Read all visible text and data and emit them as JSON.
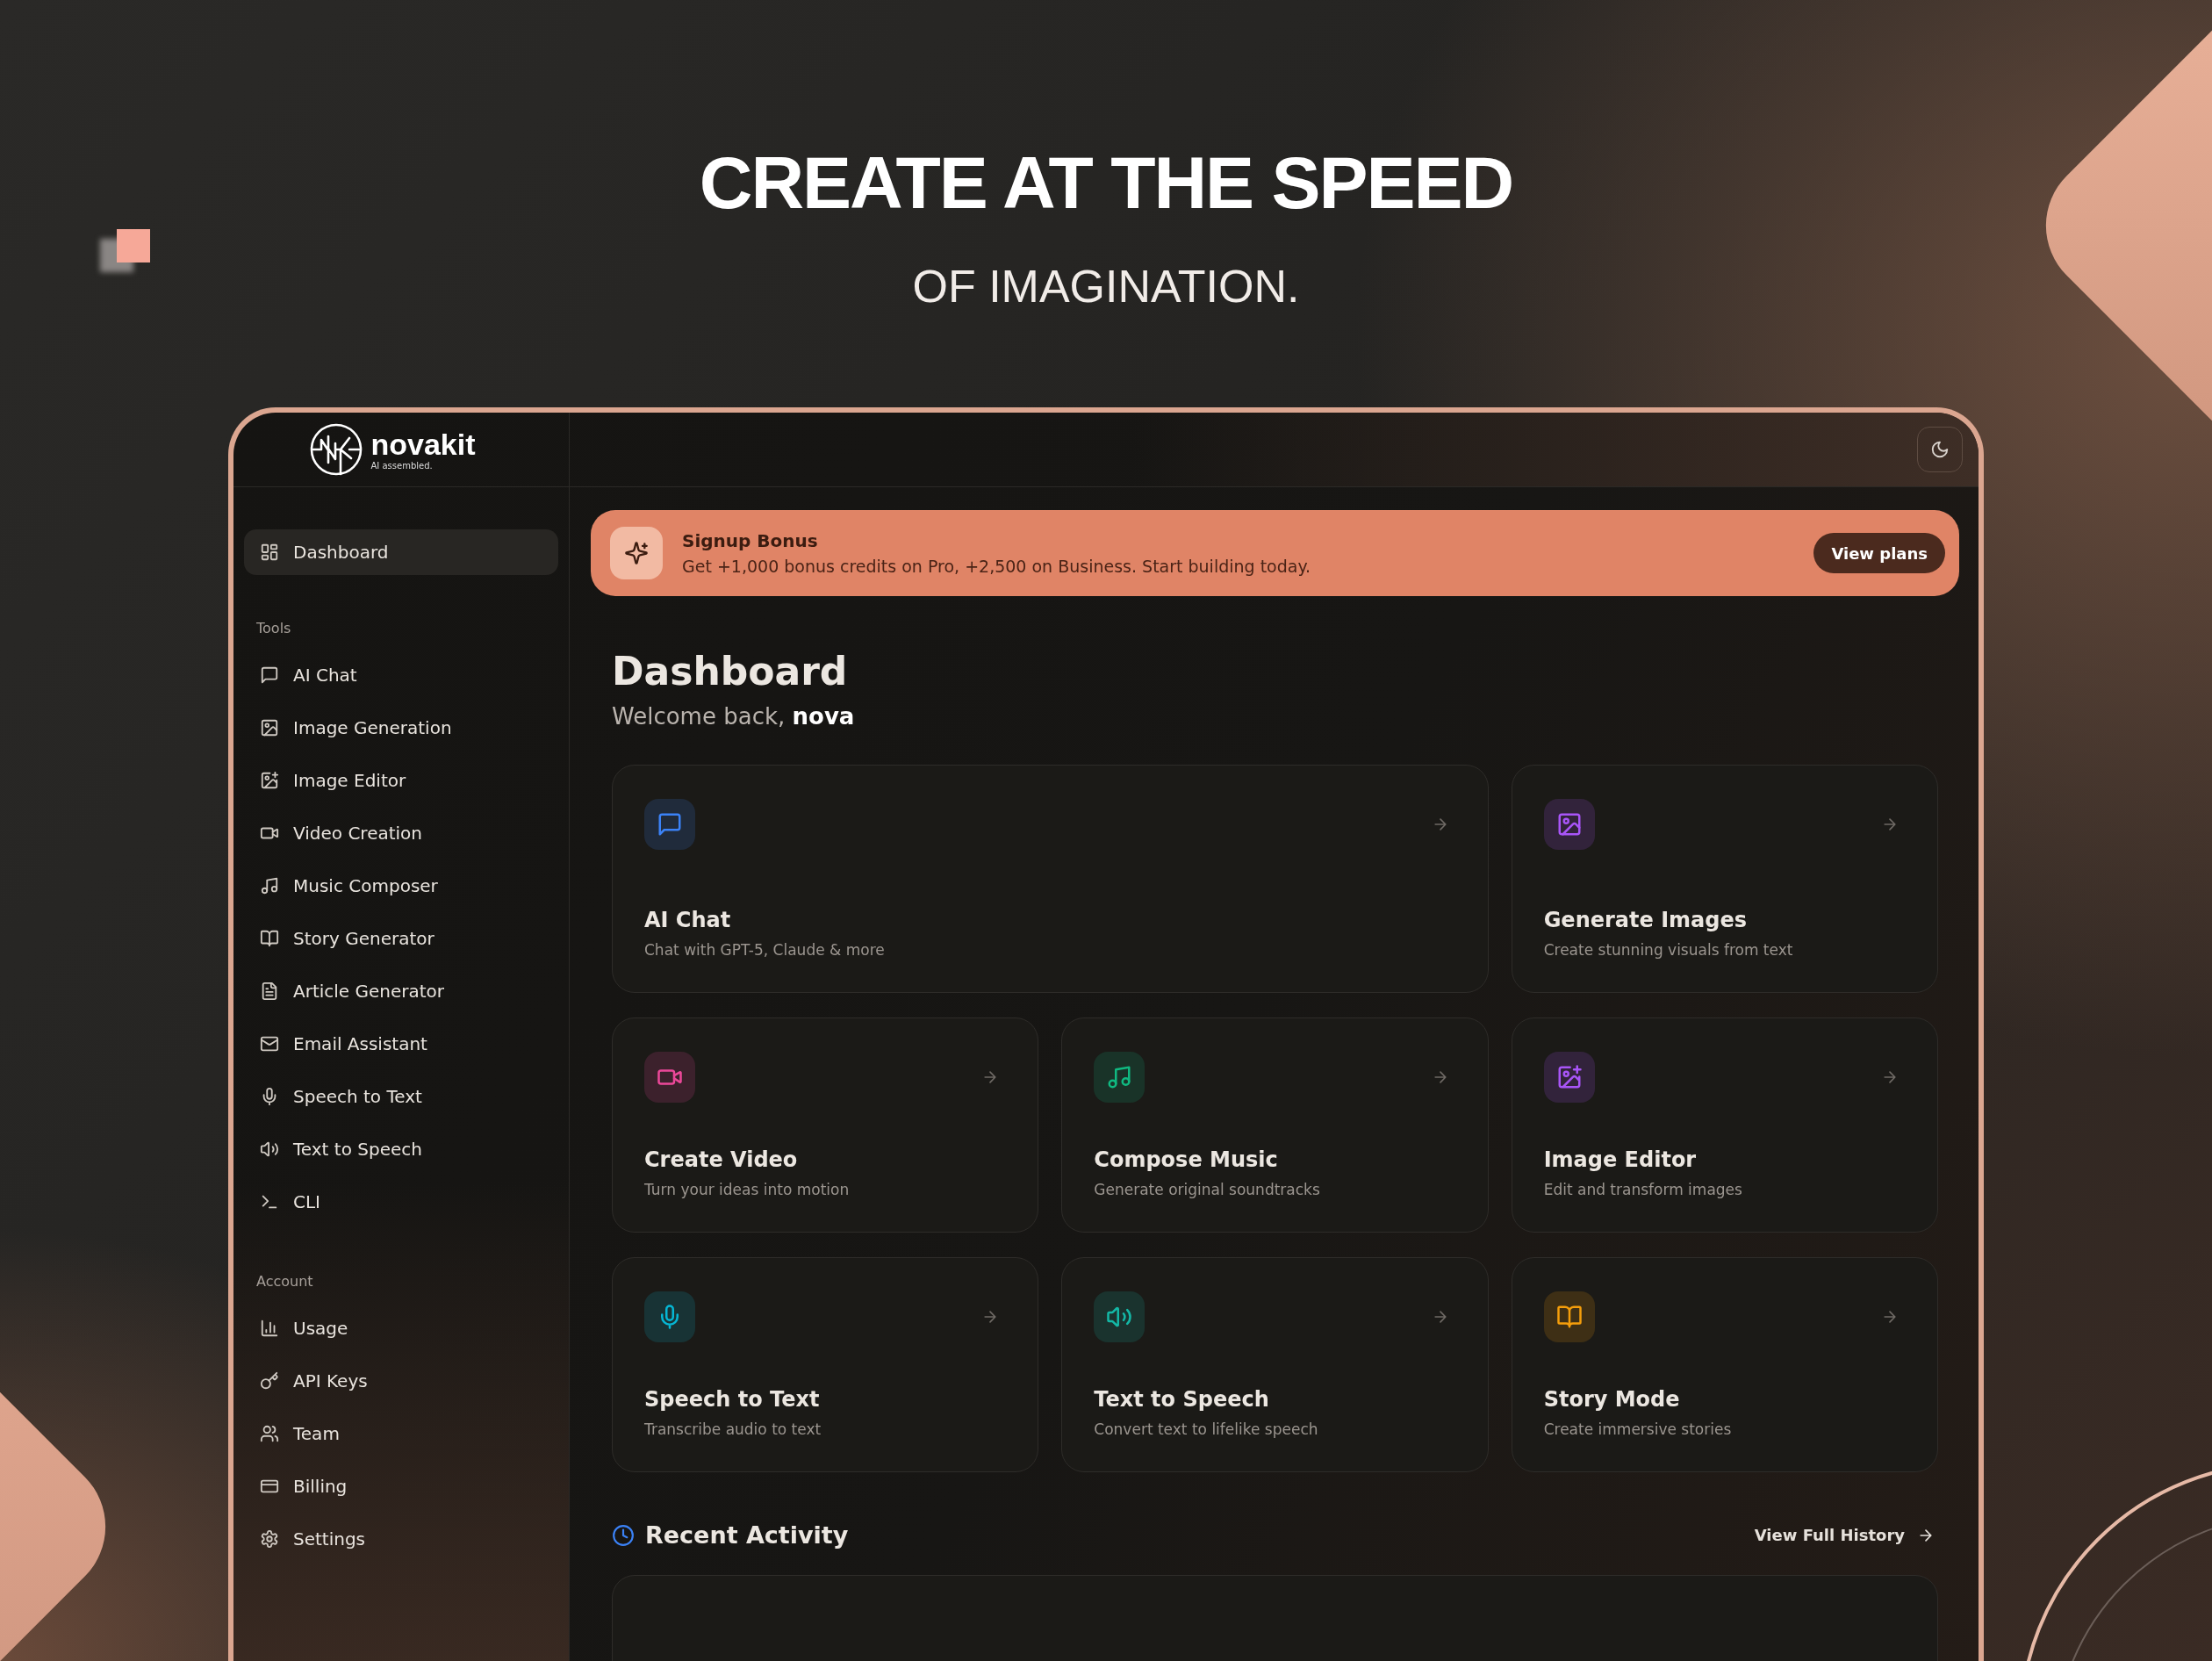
{
  "hero": {
    "title": "CREATE AT THE SPEED",
    "subtitle": "OF IMAGINATION."
  },
  "sidebar": {
    "logo": {
      "name": "novakit",
      "tagline": "AI assembled."
    },
    "sections": [
      {
        "items": [
          {
            "label": "Dashboard",
            "kind": "dashboard",
            "selected": true
          }
        ]
      },
      {
        "heading": "Tools",
        "items": [
          {
            "label": "AI Chat",
            "kind": "chat",
            "selected": false
          },
          {
            "label": "Image Generation",
            "kind": "image",
            "selected": false
          },
          {
            "label": "Image Editor",
            "kind": "imageplus",
            "selected": false
          },
          {
            "label": "Video Creation",
            "kind": "video",
            "selected": false
          },
          {
            "label": "Music Composer",
            "kind": "music",
            "selected": false
          },
          {
            "label": "Story Generator",
            "kind": "book",
            "selected": false
          },
          {
            "label": "Article Generator",
            "kind": "file",
            "selected": false
          },
          {
            "label": "Email Assistant",
            "kind": "mail",
            "selected": false
          },
          {
            "label": "Speech to Text",
            "kind": "mic",
            "selected": false
          },
          {
            "label": "Text to Speech",
            "kind": "speaker",
            "selected": false
          },
          {
            "label": "CLI",
            "kind": "terminal",
            "selected": false
          }
        ]
      },
      {
        "heading": "Account",
        "items": [
          {
            "label": "Usage",
            "kind": "chart",
            "selected": false
          },
          {
            "label": "API Keys",
            "kind": "key",
            "selected": false
          },
          {
            "label": "Team",
            "kind": "users",
            "selected": false
          },
          {
            "label": "Billing",
            "kind": "card",
            "selected": false
          },
          {
            "label": "Settings",
            "kind": "settings",
            "selected": false
          }
        ]
      }
    ]
  },
  "banner": {
    "title": "Signup Bonus",
    "text": "Get +1,000 bonus credits on Pro, +2,500 on Business. Start building today.",
    "button": "View plans"
  },
  "dashboard": {
    "title": "Dashboard",
    "greeting": "Welcome back, **nova**",
    "cards": [
      {
        "title": "AI Chat",
        "description": "Chat with GPT-5, Claude & more",
        "kind": "chat",
        "color": "#3b82f6"
      },
      {
        "title": "Generate Images",
        "description": "Create stunning visuals from text",
        "kind": "image",
        "color": "#a855f7"
      },
      {
        "title": "Create Video",
        "description": "Turn your ideas into motion",
        "kind": "video",
        "color": "#ec4899"
      },
      {
        "title": "Compose Music",
        "description": "Generate original soundtracks",
        "kind": "music",
        "color": "#10b981"
      },
      {
        "title": "Image Editor",
        "description": "Edit and transform images",
        "kind": "imageplus",
        "color": "#a855f7"
      },
      {
        "title": "Speech to Text",
        "description": "Transcribe audio to text",
        "kind": "mic",
        "color": "#06b6d4"
      },
      {
        "title": "Text to Speech",
        "description": "Convert text to lifelike speech",
        "kind": "speaker",
        "color": "#14b8a6"
      },
      {
        "title": "Story Mode",
        "description": "Create immersive stories",
        "kind": "book",
        "color": "#f59e0b"
      }
    ]
  },
  "recent_activity": {
    "title": "Recent Activity",
    "link": "View Full History"
  }
}
